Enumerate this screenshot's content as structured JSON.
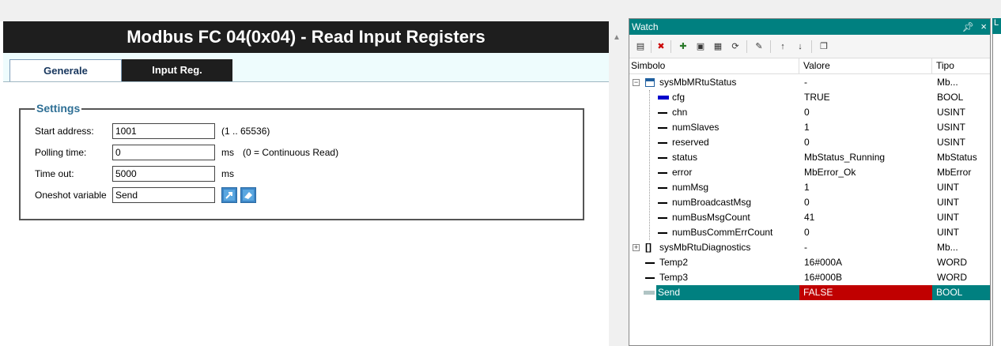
{
  "editor": {
    "title": "Modbus FC 04(0x04) - Read Input Registers",
    "tabs": [
      {
        "label": "Generale",
        "active": true
      },
      {
        "label": "Input Reg.",
        "active": false
      }
    ],
    "settings": {
      "legend": "Settings",
      "start_address": {
        "label": "Start address:",
        "value": "1001",
        "hint": "(1 .. 65536)"
      },
      "polling_time": {
        "label": "Polling time:",
        "value": "0",
        "unit": "ms",
        "hint": "(0 = Continuous Read)"
      },
      "time_out": {
        "label": "Time out:",
        "value": "5000",
        "unit": "ms"
      },
      "oneshot": {
        "label": "Oneshot variable",
        "value": "Send"
      }
    }
  },
  "watch": {
    "title": "Watch",
    "pin_icon": "pin-icon",
    "close_glyph": "×",
    "stub_label": "L",
    "columns": {
      "name": "Simbolo",
      "value": "Valore",
      "type": "Tipo"
    },
    "rows": [
      {
        "name": "sysMbMRtuStatus",
        "value": "-",
        "type": "Mb...",
        "level": 0,
        "expander": "−",
        "icon": "struct-icon"
      },
      {
        "name": "cfg",
        "value": "TRUE",
        "type": "BOOL",
        "level": 1,
        "icon": "bool-true-icon"
      },
      {
        "name": "chn",
        "value": "0",
        "type": "USINT",
        "level": 1
      },
      {
        "name": "numSlaves",
        "value": "1",
        "type": "USINT",
        "level": 1
      },
      {
        "name": "reserved",
        "value": "0",
        "type": "USINT",
        "level": 1
      },
      {
        "name": "status",
        "value": "MbStatus_Running",
        "type": "MbStatus",
        "level": 1
      },
      {
        "name": "error",
        "value": "MbError_Ok",
        "type": "MbError",
        "level": 1
      },
      {
        "name": "numMsg",
        "value": "1",
        "type": "UINT",
        "level": 1
      },
      {
        "name": "numBroadcastMsg",
        "value": "0",
        "type": "UINT",
        "level": 1
      },
      {
        "name": "numBusMsgCount",
        "value": "41",
        "type": "UINT",
        "level": 1
      },
      {
        "name": "numBusCommErrCount",
        "value": "0",
        "type": "UINT",
        "level": 1
      },
      {
        "name": "sysMbRtuDiagnostics",
        "value": "-",
        "type": "Mb...",
        "level": 0,
        "expander": "+",
        "icon": "array-icon"
      },
      {
        "name": "Temp2",
        "value": "16#000A",
        "type": "WORD",
        "level": 0
      },
      {
        "name": "Temp3",
        "value": "16#000B",
        "type": "WORD",
        "level": 0
      },
      {
        "name": "Send",
        "value": "FALSE",
        "type": "BOOL",
        "level": 0,
        "selected": true,
        "icon": "bool-false-icon"
      }
    ]
  },
  "colors": {
    "accent": "#008080",
    "false_value": "#c00000",
    "title_bar": "#1e1e1e"
  }
}
